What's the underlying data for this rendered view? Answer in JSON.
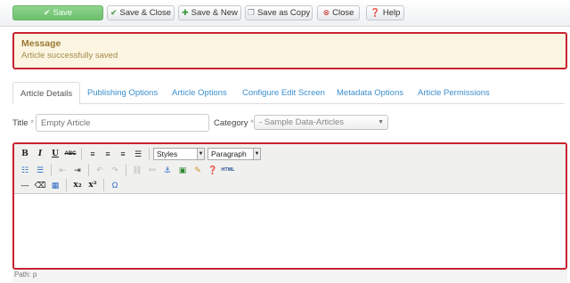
{
  "toolbar": {
    "save": {
      "label": "Save",
      "icon": "check-icon"
    },
    "save_close": {
      "label": "Save & Close",
      "icon": "check-icon"
    },
    "save_new": {
      "label": "Save & New",
      "icon": "plus-icon"
    },
    "save_copy": {
      "label": "Save as Copy",
      "icon": "copy-icon"
    },
    "close": {
      "label": "Close",
      "icon": "cancel-icon"
    },
    "help": {
      "label": "Help",
      "icon": "question-icon"
    }
  },
  "message": {
    "heading": "Message",
    "text": "Article successfully saved"
  },
  "tabs": [
    {
      "label": "Article Details",
      "active": true
    },
    {
      "label": "Publishing Options",
      "active": false
    },
    {
      "label": "Article Options",
      "active": false
    },
    {
      "label": "Configure Edit Screen",
      "active": false
    },
    {
      "label": "Metadata Options",
      "active": false
    },
    {
      "label": "Article Permissions",
      "active": false
    }
  ],
  "form": {
    "title_label": "Title",
    "required_mark": "*",
    "title_placeholder": "Empty Article",
    "category_label": "Category",
    "category_value": "- Sample Data-Articles"
  },
  "editor": {
    "styles_value": "Styles",
    "format_value": "Paragraph",
    "html_label": "HTML",
    "path": "Path: p"
  },
  "colors": {
    "highlight_border": "#c8232f",
    "save_green": "#6cbf6c",
    "link_blue": "#3b8fcd",
    "message_bg": "#fbf5e1"
  }
}
